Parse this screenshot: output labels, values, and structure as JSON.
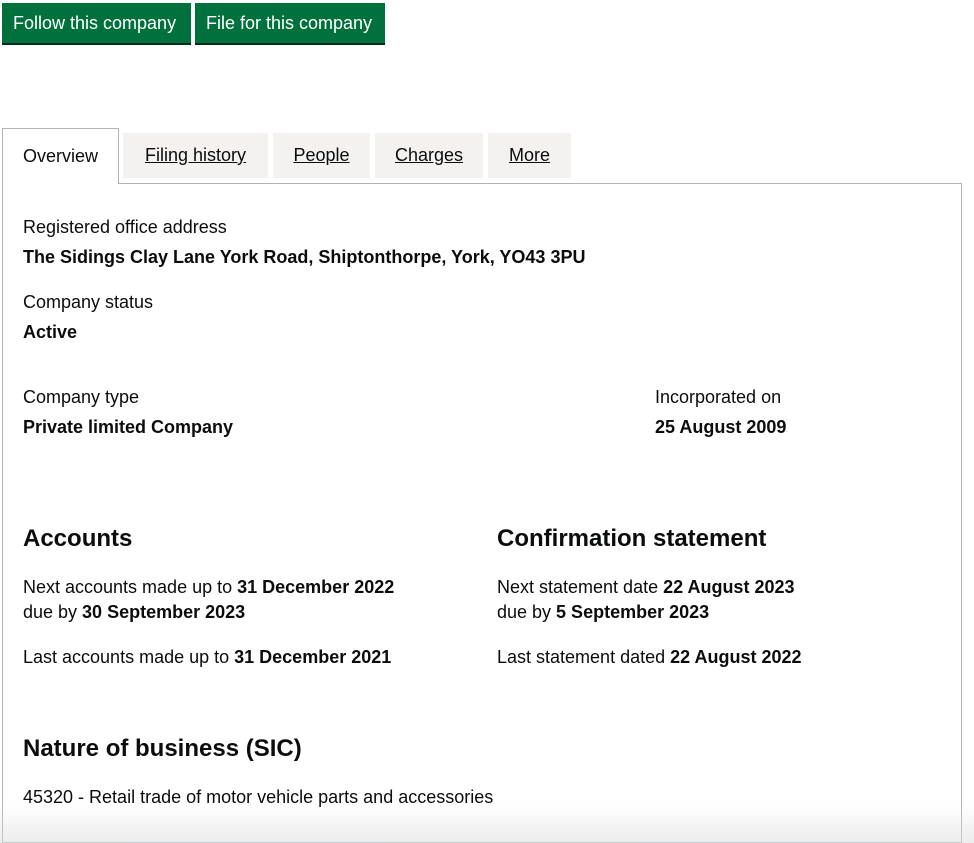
{
  "actions": {
    "follow_label": "Follow this company",
    "file_label": "File for this company"
  },
  "tabs": [
    {
      "label": "Overview",
      "active": true
    },
    {
      "label": "Filing history",
      "active": false
    },
    {
      "label": "People",
      "active": false
    },
    {
      "label": "Charges",
      "active": false
    },
    {
      "label": "More",
      "active": false
    }
  ],
  "overview": {
    "registered_office_label": "Registered office address",
    "registered_office_value": "The Sidings Clay Lane York Road, Shiptonthorpe, York, YO43 3PU",
    "status_label": "Company status",
    "status_value": "Active",
    "type_label": "Company type",
    "type_value": "Private limited Company",
    "incorporated_label": "Incorporated on",
    "incorporated_value": "25 August 2009"
  },
  "accounts": {
    "heading": "Accounts",
    "next_prefix": "Next accounts made up to ",
    "next_date": "31 December 2022",
    "due_prefix": "due by ",
    "due_date": "30 September 2023",
    "last_prefix": "Last accounts made up to ",
    "last_date": "31 December 2021"
  },
  "confirmation": {
    "heading": "Confirmation statement",
    "next_prefix": "Next statement date ",
    "next_date": "22 August 2023",
    "due_prefix": "due by ",
    "due_date": "5 September 2023",
    "last_prefix": "Last statement dated ",
    "last_date": "22 August 2022"
  },
  "sic": {
    "heading": "Nature of business (SIC)",
    "item": "45320 - Retail trade of motor vehicle parts and accessories"
  },
  "colors": {
    "button_green": "#00703c",
    "tab_inactive_bg": "#f3f2f1",
    "border": "#b1b4b6",
    "text": "#0b0c0c"
  }
}
